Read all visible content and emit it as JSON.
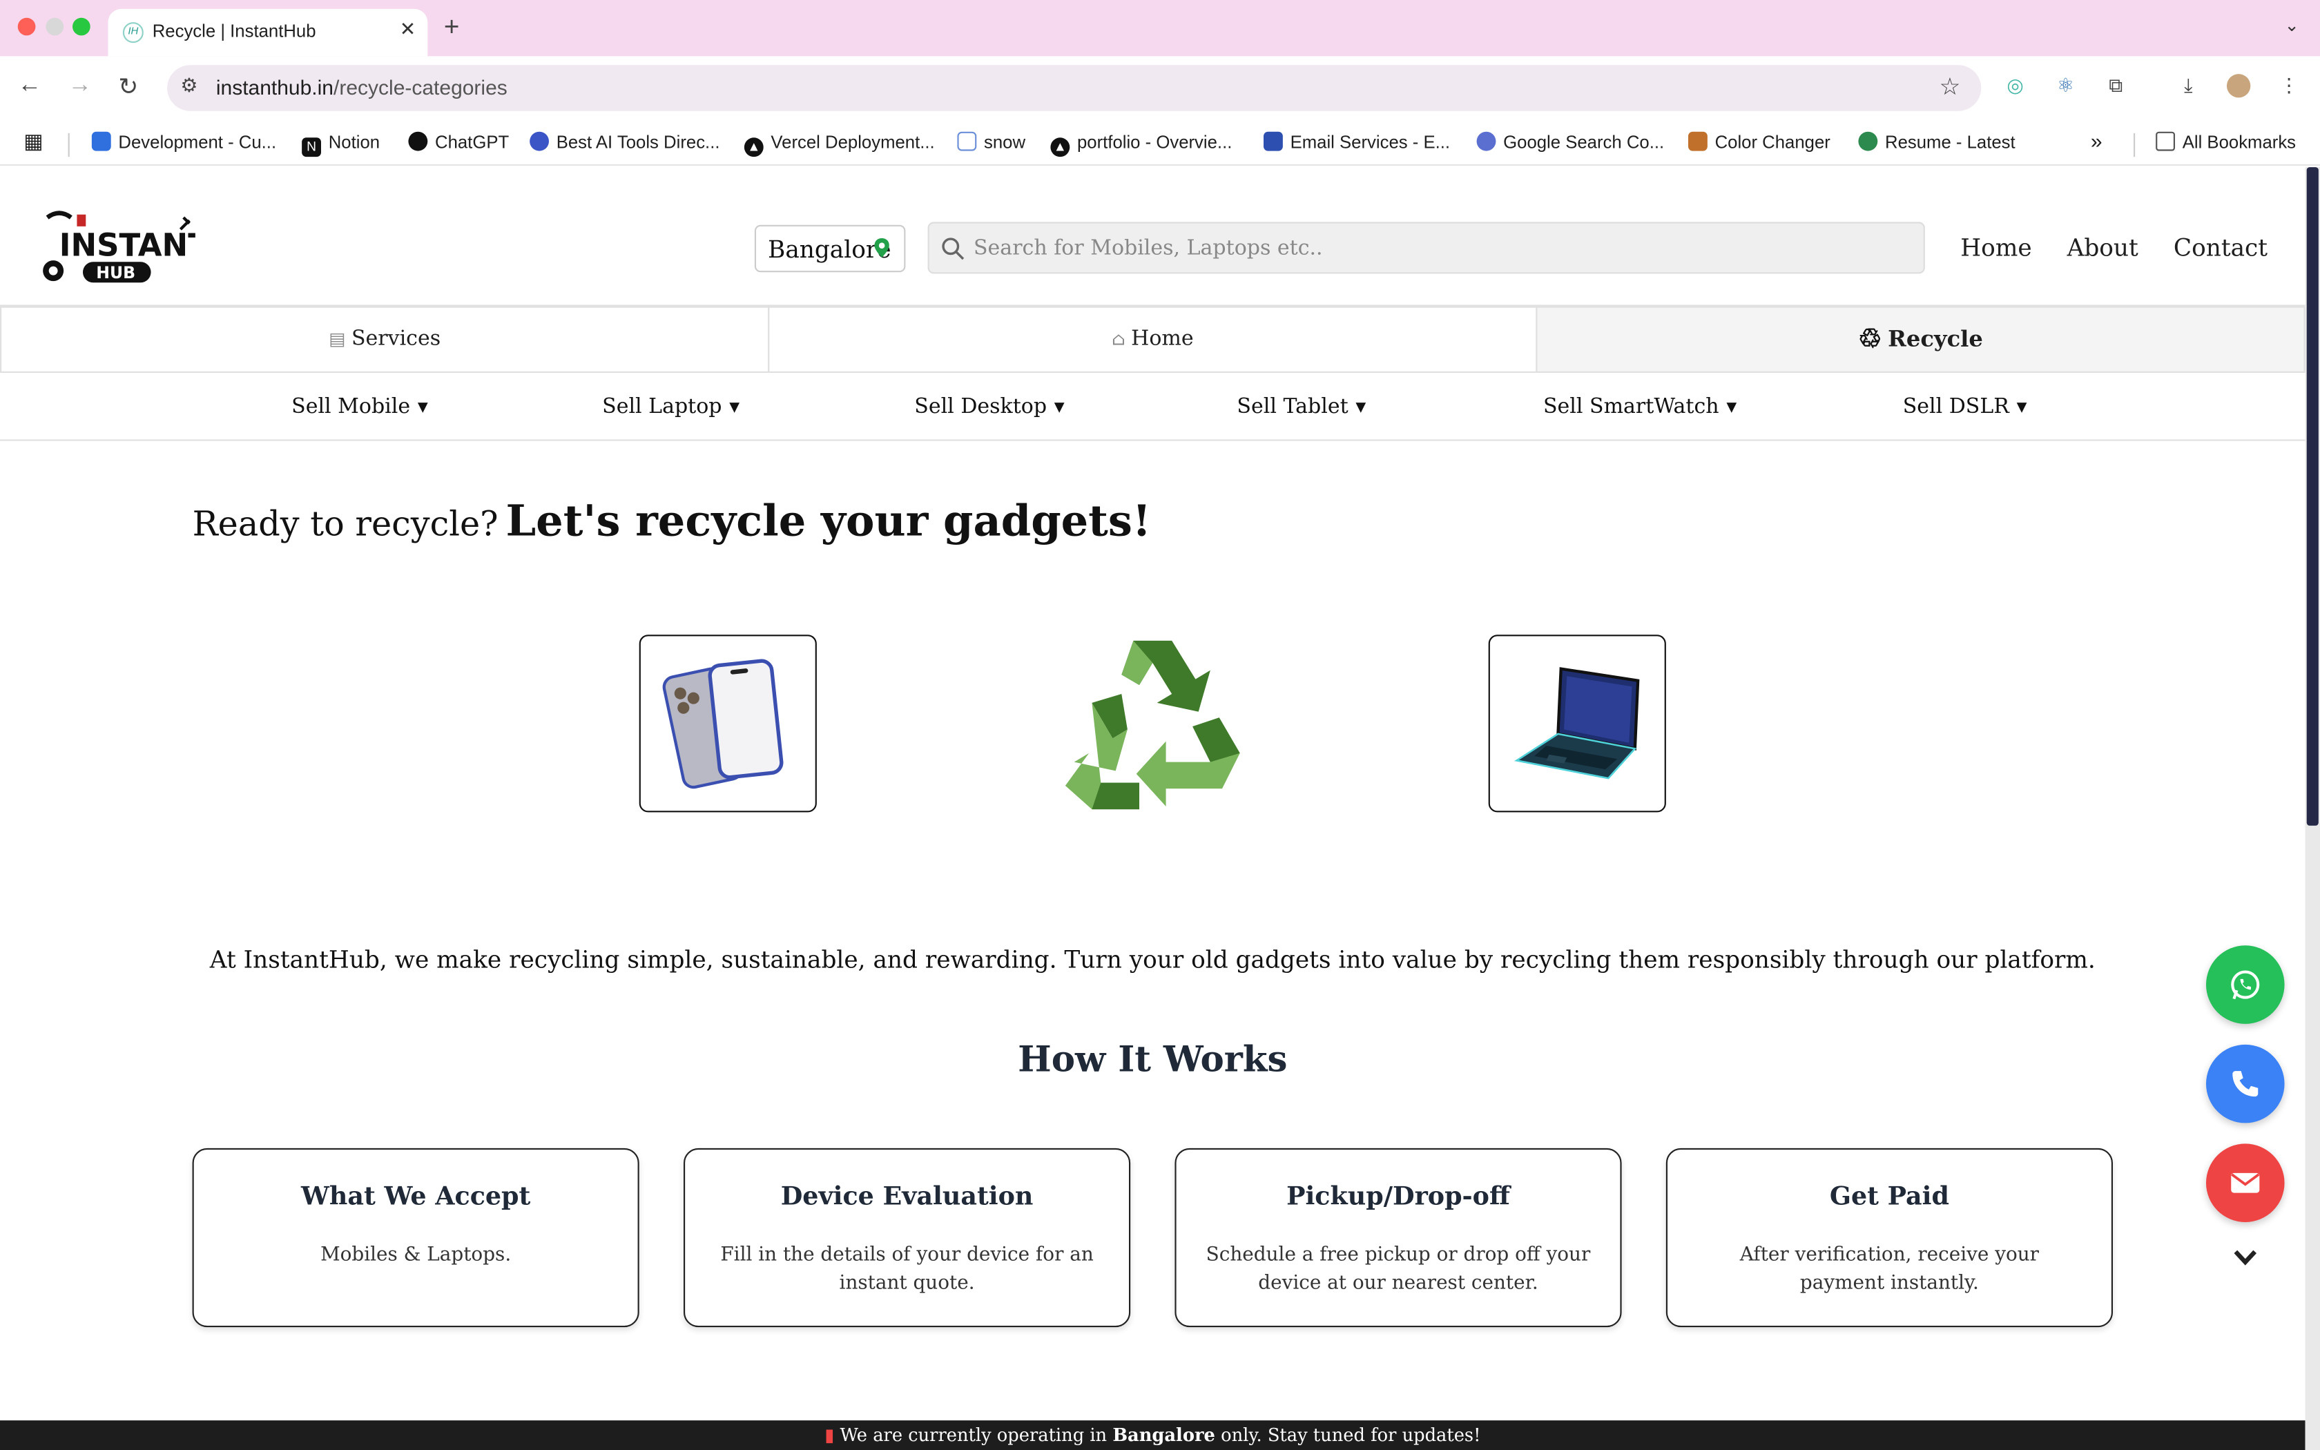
{
  "browser": {
    "tab_title": "Recycle | InstantHub",
    "tab_favicon_text": "IH",
    "url_domain": "instanthub.in",
    "url_path": "/recycle-categories",
    "bookmarks": [
      {
        "label": "Development - Cu...",
        "icon": "jira-icon",
        "color": "#2f6fde"
      },
      {
        "label": "Notion",
        "icon": "notion-icon",
        "color": "#111111"
      },
      {
        "label": "ChatGPT",
        "icon": "openai-icon",
        "color": "#111111"
      },
      {
        "label": "Best AI Tools Direc...",
        "icon": "gear-icon",
        "color": "#3b55c7"
      },
      {
        "label": "Vercel Deployment...",
        "icon": "vercel-icon",
        "color": "#111111"
      },
      {
        "label": "snow",
        "icon": "window-icon",
        "color": "#6b8fd8"
      },
      {
        "label": "portfolio - Overvie...",
        "icon": "vercel-icon",
        "color": "#111111"
      },
      {
        "label": "Email Services - E...",
        "icon": "shield-icon",
        "color": "#2d4fb0"
      },
      {
        "label": "Google Search Co...",
        "icon": "search-console-icon",
        "color": "#5b6fd0"
      },
      {
        "label": "Color Changer",
        "icon": "tools-icon",
        "color": "#c0702b"
      },
      {
        "label": "Resume - Latest",
        "icon": "leaf-icon",
        "color": "#2d8a4e"
      }
    ],
    "all_bookmarks": "All Bookmarks"
  },
  "site": {
    "location": "Bangalore",
    "search_placeholder": "Search for Mobiles, Laptops etc..",
    "nav": [
      "Home",
      "About",
      "Contact"
    ],
    "tabs": [
      {
        "label": "Services",
        "icon": "briefcase-icon"
      },
      {
        "label": "Home",
        "icon": "home-icon"
      },
      {
        "label": "Recycle",
        "icon": "recycle-icon"
      }
    ],
    "sell_menu": [
      "Sell Mobile",
      "Sell Laptop",
      "Sell Desktop",
      "Sell Tablet",
      "Sell SmartWatch",
      "Sell DSLR"
    ],
    "hero_small": "Ready to recycle?",
    "hero_big": "Let's recycle your gadgets!",
    "description": "At InstantHub, we make recycling simple, sustainable, and rewarding. Turn your old gadgets into value by recycling them responsibly through our platform.",
    "how_title": "How It Works",
    "cards": [
      {
        "title": "What We Accept",
        "text": "Mobiles & Laptops."
      },
      {
        "title": "Device Evaluation",
        "text": "Fill in the details of your device for an instant quote."
      },
      {
        "title": "Pickup/Drop-off",
        "text": "Schedule a free pickup or drop off your device at our nearest center."
      },
      {
        "title": "Get Paid",
        "text": "After verification, receive your payment instantly."
      }
    ],
    "footer_pre": "We are currently operating in",
    "footer_city": "Bangalore",
    "footer_post": "only. Stay tuned for updates!",
    "logo_text_top": "INSTANT",
    "logo_text_bottom": "HUB"
  },
  "colors": {
    "whatsapp": "#25c05a",
    "phone": "#3b82f6",
    "email": "#ef4444",
    "recycle_dark": "#3f7a2a",
    "recycle_light": "#7ab55c"
  }
}
